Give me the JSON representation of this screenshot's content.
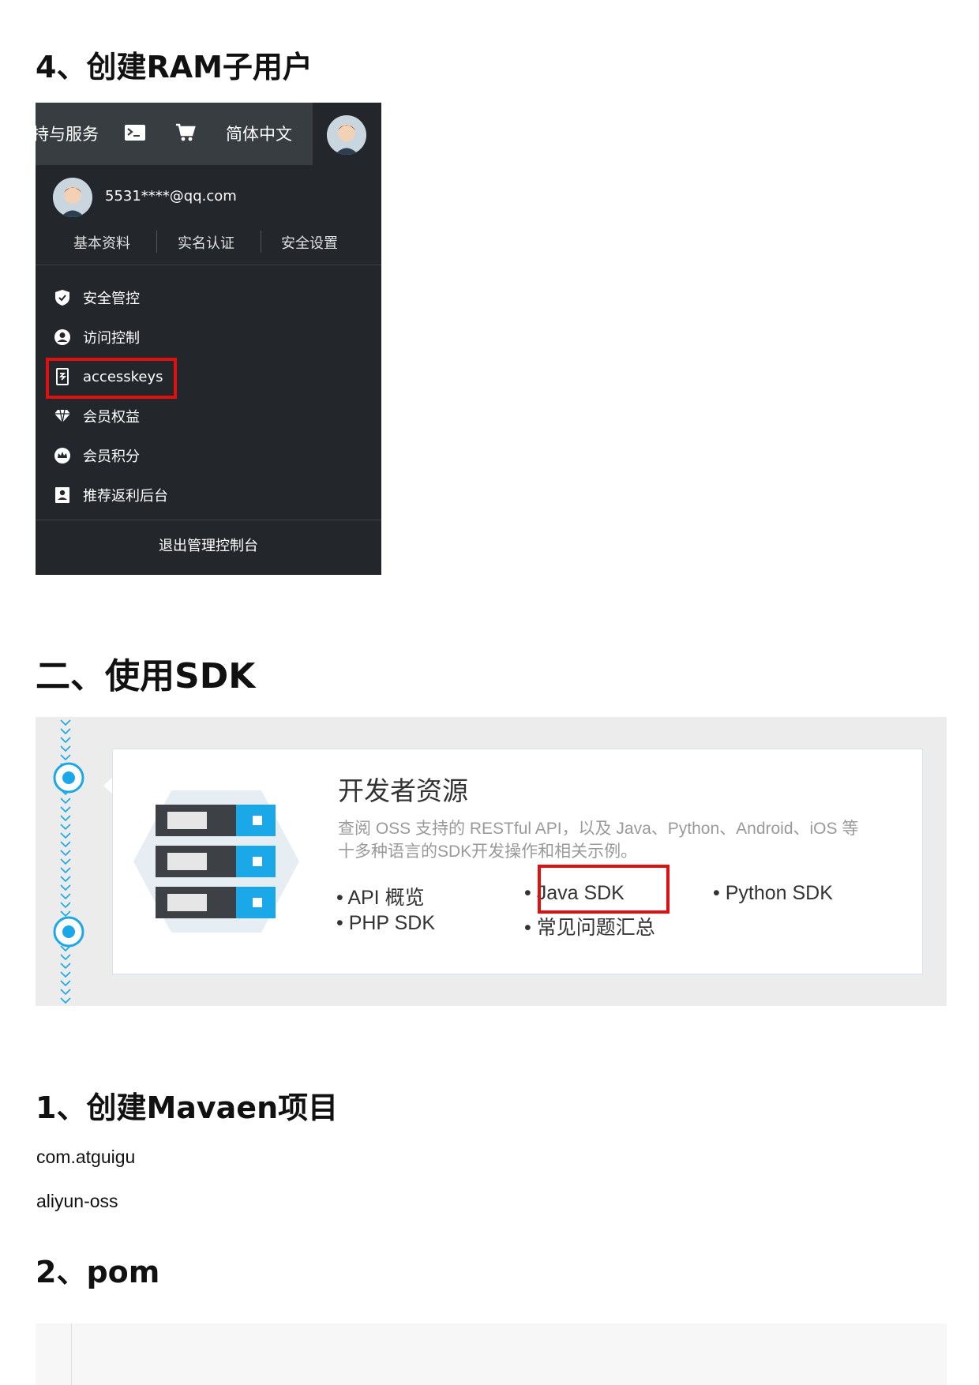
{
  "headings": {
    "step4": "4、创建RAM子用户",
    "section2": "二、使用SDK",
    "step1": "1、创建Mavaen项目",
    "step2": "2、pom"
  },
  "paragraphs": {
    "group_id": "com.atguigu",
    "artifact_id": "aliyun-oss"
  },
  "account_menu": {
    "topbar": {
      "service_label": "持与服务",
      "terminal_icon": "terminal-icon",
      "cart_icon": "cart-icon",
      "language": "简体中文"
    },
    "user_email": "5531****@qq.com",
    "tabs": [
      "基本资料",
      "实名认证",
      "安全设置"
    ],
    "items": [
      {
        "label": "安全管控",
        "icon": "shield-icon"
      },
      {
        "label": "访问控制",
        "icon": "user-icon"
      },
      {
        "label": "accesskeys",
        "icon": "key-icon",
        "highlighted": true
      },
      {
        "label": "会员权益",
        "icon": "diamond-icon"
      },
      {
        "label": "会员积分",
        "icon": "crown-icon"
      },
      {
        "label": "推荐返利后台",
        "icon": "badge-icon"
      }
    ],
    "logout": "退出管理控制台",
    "highlight_color": "#e01010"
  },
  "dev_resources": {
    "title": "开发者资源",
    "description_line1": "查阅 OSS 支持的 RESTful API，以及 Java、Python、Android、iOS 等",
    "description_line2": "十多种语言的SDK开发操作和相关示例。",
    "links": {
      "api": "API 概览",
      "php": "PHP SDK",
      "java": "Java SDK",
      "faq": "常见问题汇总",
      "python": "Python SDK"
    },
    "accent_color": "#1aa8e8",
    "icon": "server-stack-icon"
  }
}
